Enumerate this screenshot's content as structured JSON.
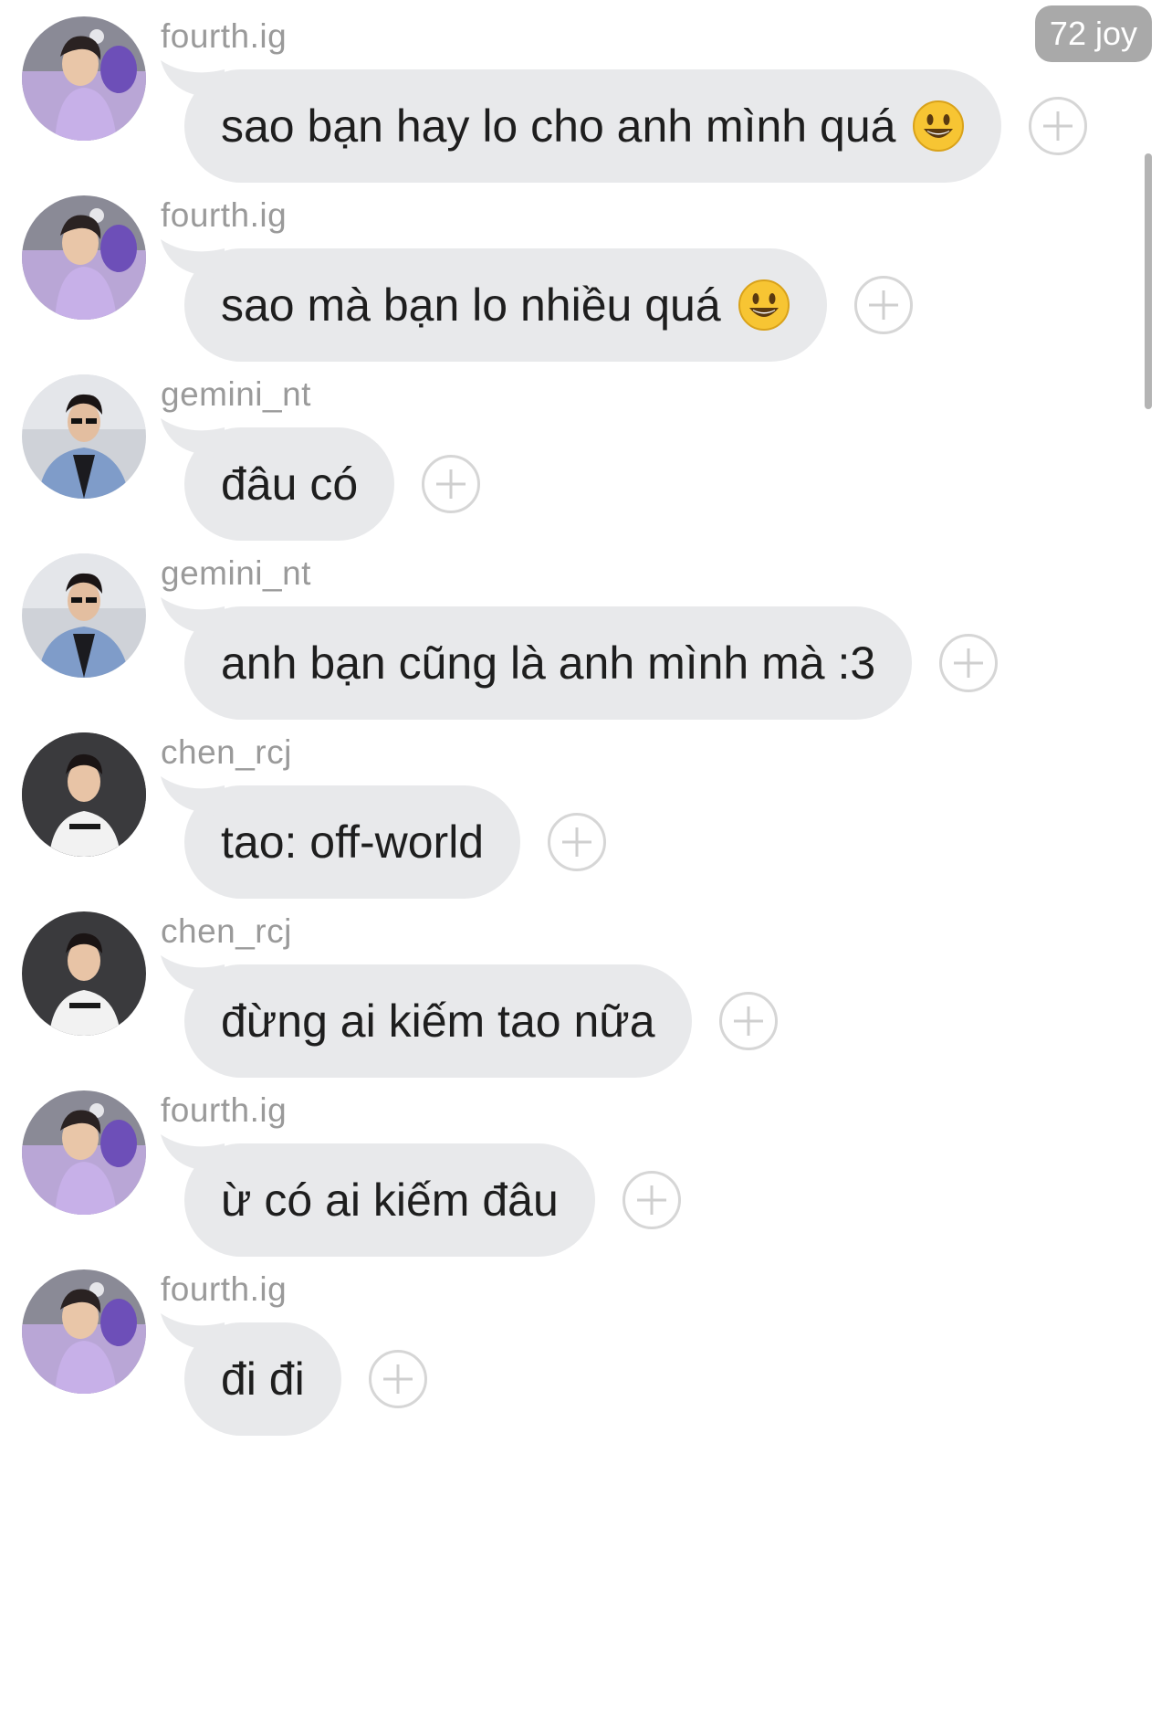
{
  "badge": {
    "joy_label": "72 joy"
  },
  "messages": [
    {
      "user": "fourth.ig",
      "avatar": "fourth-avatar",
      "text": "sao bạn hay lo cho anh mình quá",
      "emoji": "smiley-emoji"
    },
    {
      "user": "fourth.ig",
      "avatar": "fourth-avatar",
      "text": "sao mà bạn lo nhiều quá",
      "emoji": "smiley-emoji"
    },
    {
      "user": "gemini_nt",
      "avatar": "gemini-avatar",
      "text": "đâu có",
      "emoji": null
    },
    {
      "user": "gemini_nt",
      "avatar": "gemini-avatar",
      "text": "anh bạn cũng là anh mình mà :3",
      "emoji": null
    },
    {
      "user": "chen_rcj",
      "avatar": "chen-avatar",
      "text": "tao: off-world",
      "emoji": null
    },
    {
      "user": "chen_rcj",
      "avatar": "chen-avatar",
      "text": "đừng ai kiếm tao nữa",
      "emoji": null
    },
    {
      "user": "fourth.ig",
      "avatar": "fourth-avatar",
      "text": "ừ có ai kiếm đâu",
      "emoji": null
    },
    {
      "user": "fourth.ig",
      "avatar": "fourth-avatar",
      "text": "đi đi",
      "emoji": null
    }
  ],
  "colors": {
    "bubble": "#e8e9eb",
    "username": "#9a9a9a",
    "badge": "#a9a9a9"
  }
}
